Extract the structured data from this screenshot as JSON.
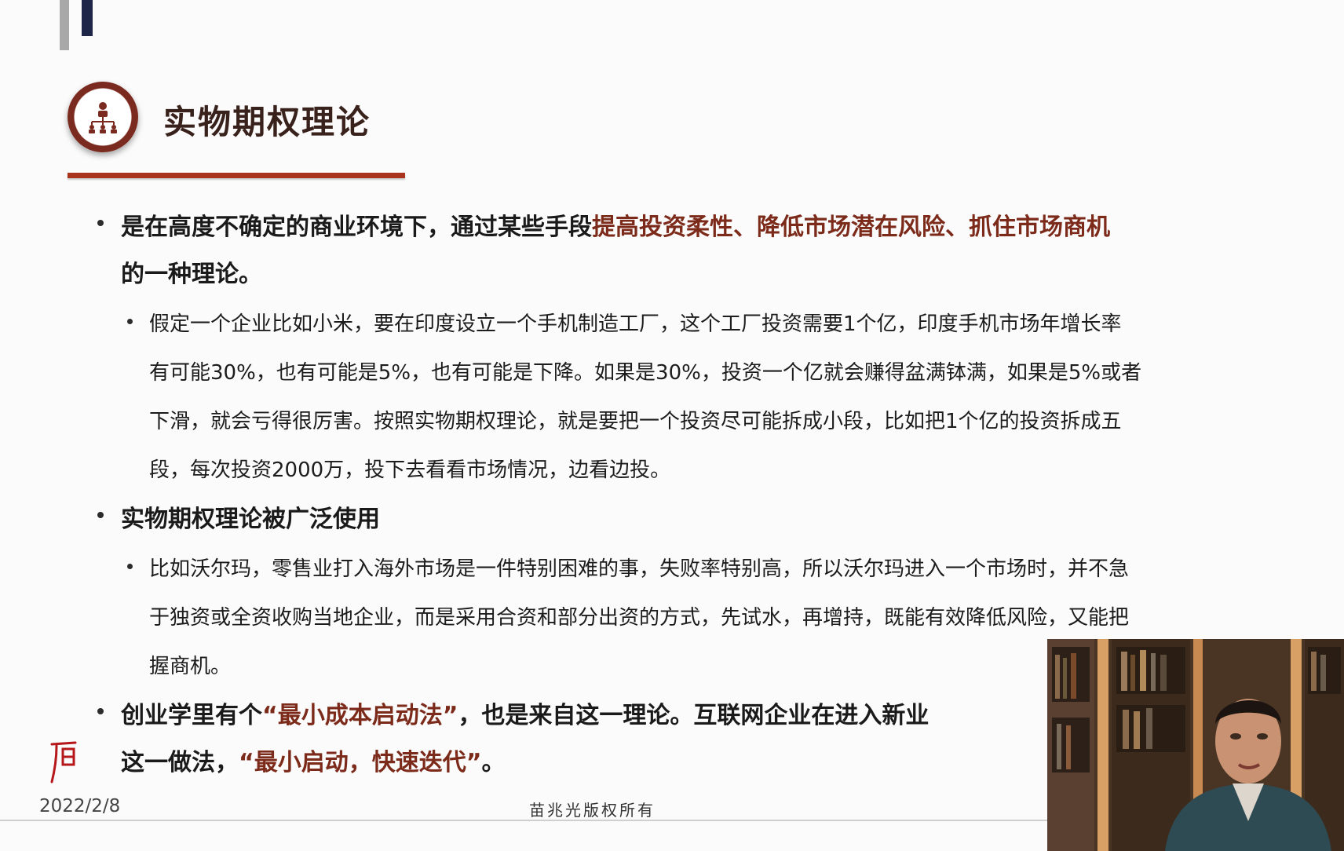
{
  "slide": {
    "title": "实物期权理论",
    "title_icon": "org-chart-icon",
    "colors": {
      "title_rule": "#a8341d",
      "highlight": "#7c2a1a",
      "icon_ring": "#7a2a1e"
    }
  },
  "points": [
    {
      "lines": [
        {
          "pre": "是在高度不确定的商业环境下，通过某些手段",
          "hl": "提高投资柔性、降低市场潜在风险、抓住市场商机",
          "post": ""
        },
        {
          "pre": "的一种理论。",
          "hl": "",
          "post": ""
        }
      ],
      "sub": [
        "假定一个企业比如小米，要在印度设立一个手机制造工厂，这个工厂投资需要1个亿，印度手机市场年增长率",
        "有可能30%，也有可能是5%，也有可能是下降。如果是30%，投资一个亿就会赚得盆满钵满，如果是5%或者",
        "下滑，就会亏得很厉害。按照实物期权理论，就是要把一个投资尽可能拆成小段，比如把1个亿的投资拆成五",
        "段，每次投资2000万，投下去看看市场情况，边看边投。"
      ]
    },
    {
      "lines": [
        {
          "pre": "实物期权理论被广泛使用",
          "hl": "",
          "post": ""
        }
      ],
      "sub": [
        "比如沃尔玛，零售业打入海外市场是一件特别困难的事，失败率特别高，所以沃尔玛进入一个市场时，并不急",
        "于独资或全资收购当地企业，而是采用合资和部分出资的方式，先试水，再增持，既能有效降低风险，又能把",
        "握商机。"
      ]
    },
    {
      "lines": [
        {
          "pre": "创业学里有个",
          "hl": "“最小成本启动法”",
          "post": "，也是来自这一理论。互联网企业在进入新业"
        },
        {
          "pre": "这一做法，",
          "hl": "“最小启动，快速迭代”",
          "post": "。"
        }
      ],
      "sub": []
    }
  ],
  "footer": {
    "date": "2022/2/8",
    "copyright": "苗兆光版权所有",
    "seal_icon": "red-seal-mark-icon"
  },
  "webcam": {
    "icon": "presenter-video-feed"
  }
}
